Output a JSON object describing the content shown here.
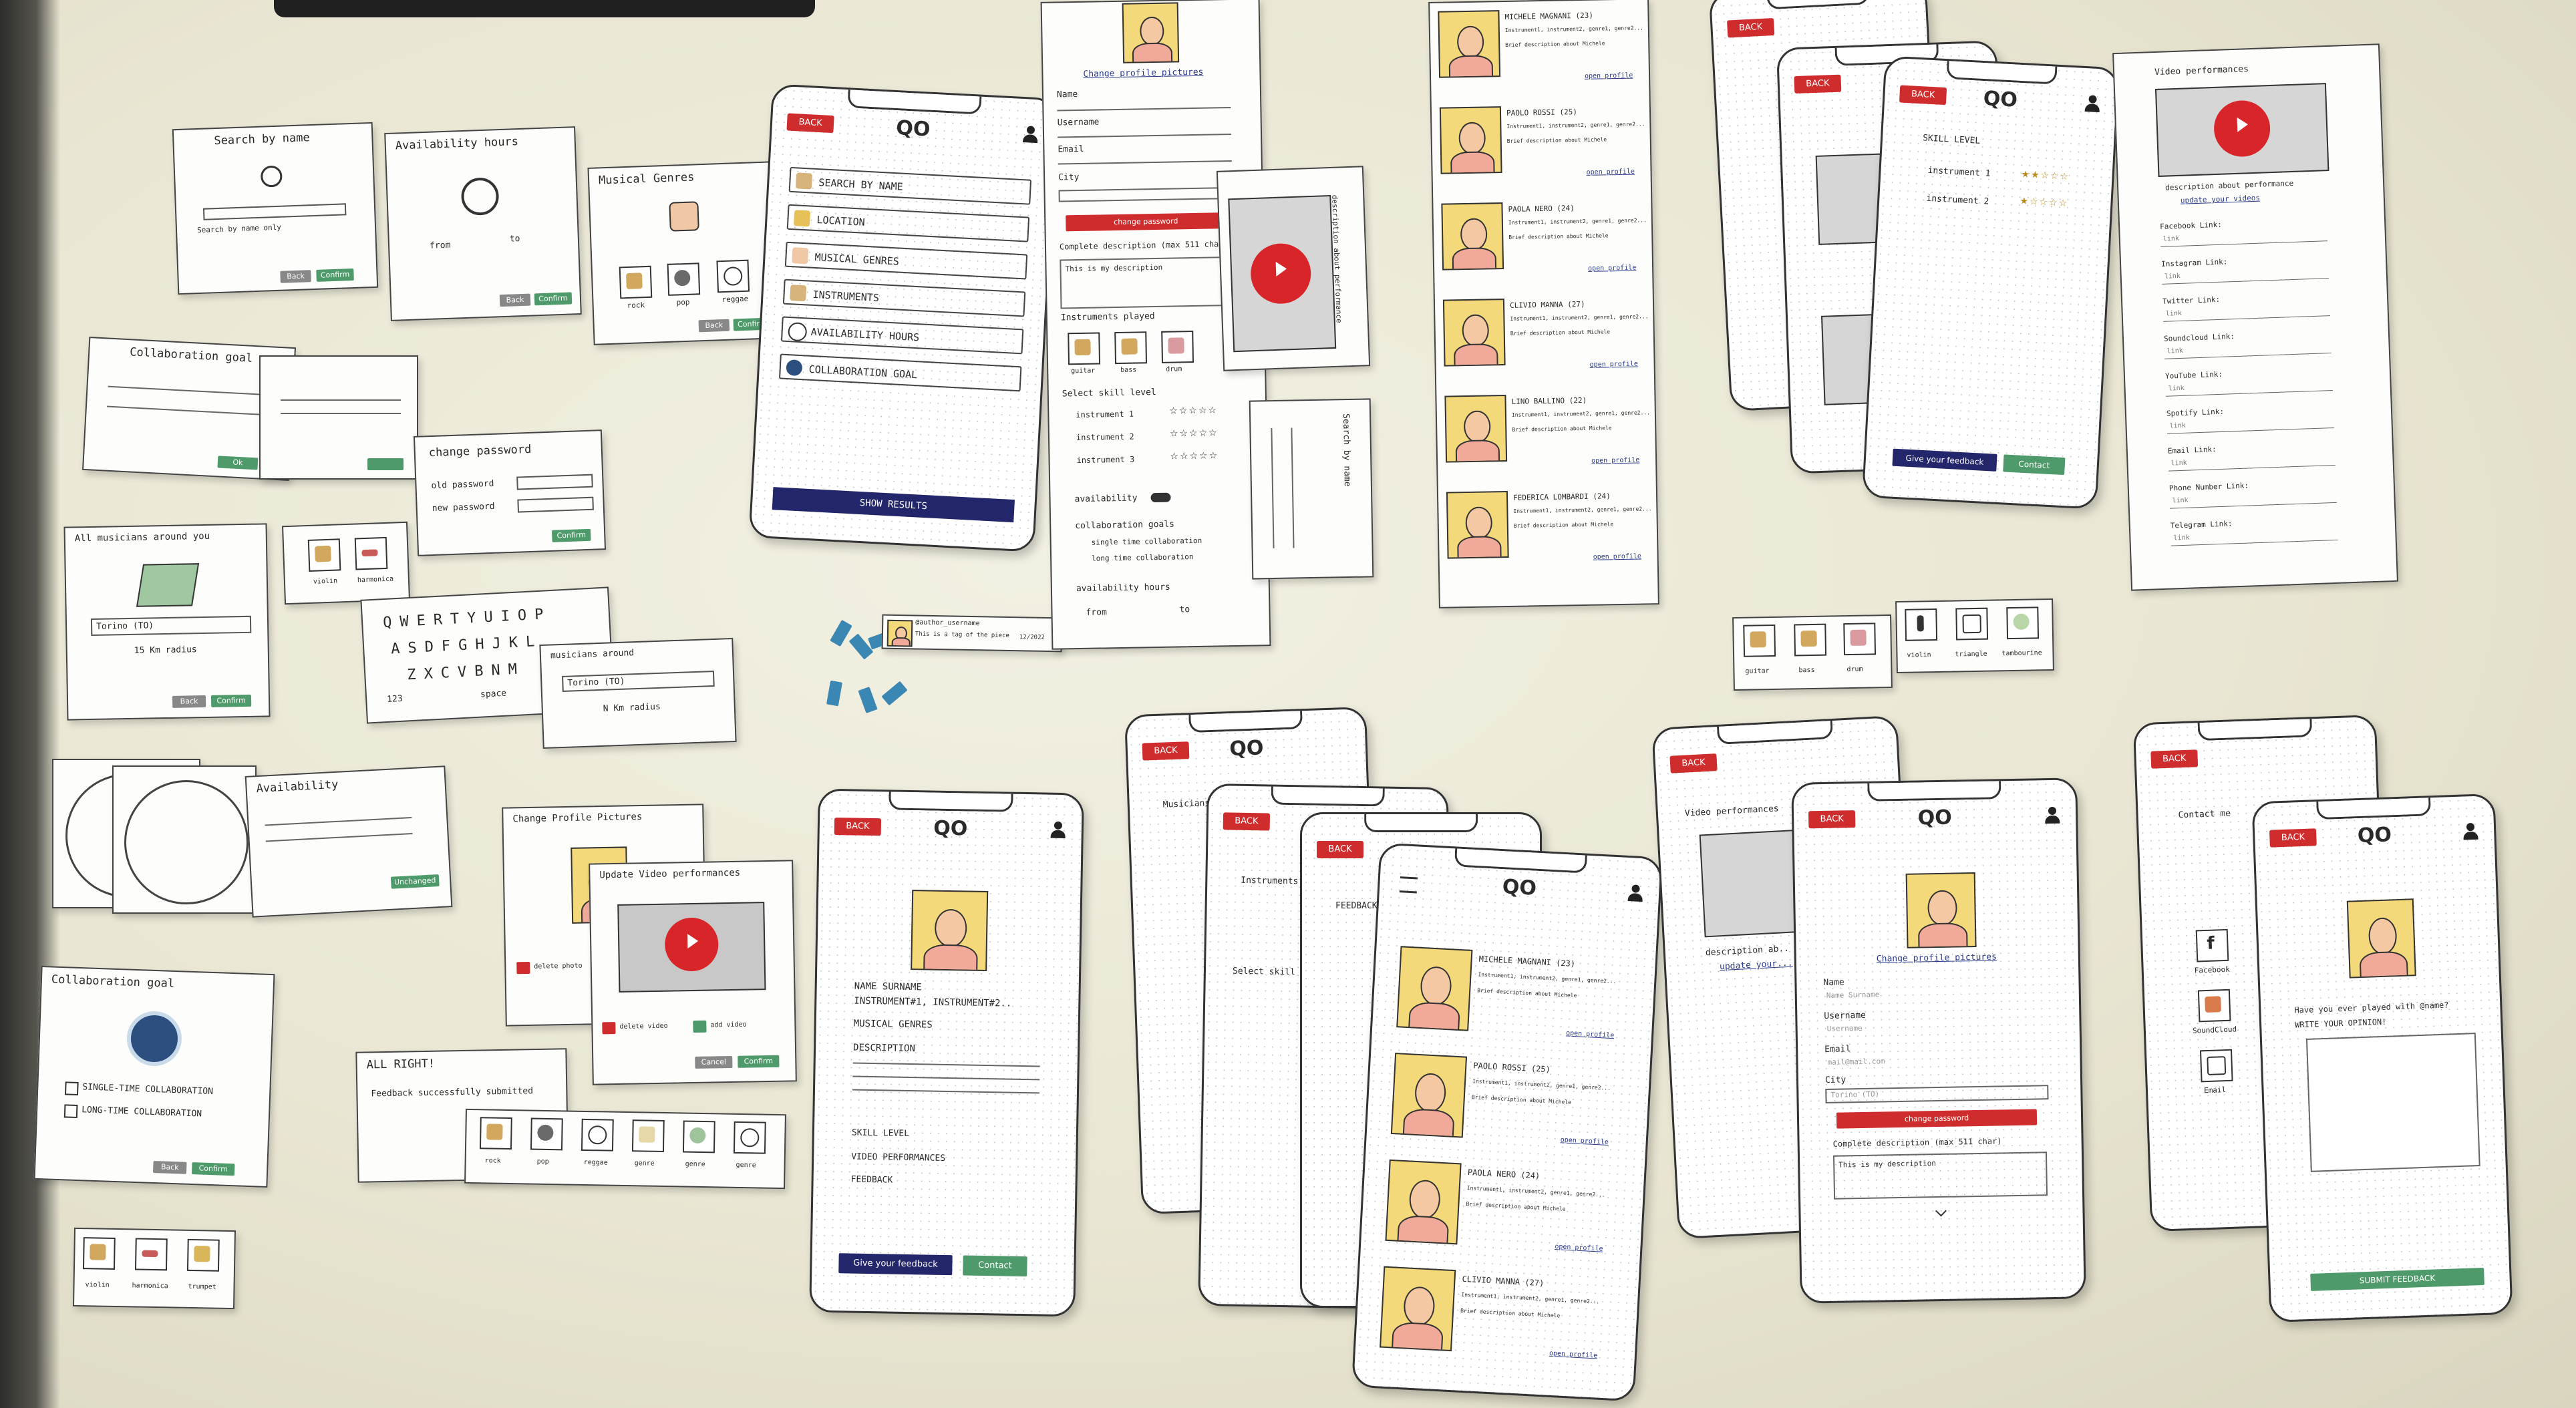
{
  "scene": {
    "description_label": "",
    "colors": {
      "desk": "#e9e6d3",
      "paper": "#fdfdfb",
      "brand_red": "#cf2d2d",
      "navy": "#23266a",
      "green": "#4f9a6a",
      "face_yellow": "#f4d97a",
      "play_red": "#d8252a"
    }
  },
  "cards": {
    "search_by_name": {
      "title": "Search by name",
      "line": "Search by name only",
      "back": "Back",
      "confirm": "Confirm"
    },
    "availability_hours": {
      "title": "Availability hours",
      "from": "from",
      "to": "to",
      "back": "Back",
      "confirm": "Confirm"
    },
    "musical_genres": {
      "title": "Musical Genres",
      "labels": [
        "rock",
        "pop",
        "reggae"
      ],
      "back": "Back",
      "confirm": "Confirm"
    },
    "collaboration_goal_small": {
      "title": "Collaboration goal",
      "ok": "Ok"
    },
    "change_password": {
      "title": "change password",
      "old": "old password",
      "new": "new password",
      "confirm": "Confirm"
    },
    "all_musicians": {
      "title": "All musicians around you",
      "field": "Torino (TO)",
      "link": "15 Km radius",
      "back": "Back",
      "confirm": "Confirm"
    },
    "instr_chips_mid": {
      "labels": [
        "violin",
        "harmonica"
      ]
    },
    "musicians_around": {
      "title": "musicians around",
      "field": "Torino (TO)",
      "radius": "N Km radius"
    },
    "availability": {
      "title": "Availability",
      "confirm": "Unchanged"
    },
    "change_profile_pictures": {
      "title": "Change Profile Pictures",
      "delete": "delete photo"
    },
    "update_video": {
      "title": "Update Video performances",
      "delete": "delete video",
      "add": "add video",
      "cancel": "Cancel",
      "confirm": "Confirm"
    },
    "collaboration_goal": {
      "title": "Collaboration goal",
      "opt1": "SINGLE-TIME COLLABORATION",
      "opt2": "LONG-TIME COLLABORATION",
      "back": "Back",
      "confirm": "Confirm"
    },
    "all_right": {
      "title": "ALL RIGHT!",
      "msg": "Feedback successfully submitted"
    },
    "genre_row": {
      "labels": [
        "rock",
        "pop",
        "reggae",
        "genre",
        "genre",
        "genre"
      ]
    },
    "instr_chips_bottom": {
      "labels": [
        "violin",
        "harmonica",
        "trumpet"
      ]
    },
    "instr_chips_right": {
      "labels": [
        "guitar",
        "bass",
        "drum",
        "violin",
        "triangle",
        "tambourine"
      ]
    }
  },
  "search_phone": {
    "back": "BACK",
    "logo": "QO",
    "rows": [
      "SEARCH BY NAME",
      "LOCATION",
      "MUSICAL GENRES",
      "INSTRUMENTS",
      "AVAILABILITY HOURS",
      "COLLABORATION GOAL"
    ],
    "show_results": "SHOW RESULTS"
  },
  "edit_profile_strip": {
    "change_pics": "Change profile pictures",
    "fields": [
      "Name",
      "Username",
      "Email",
      "City"
    ],
    "change_password": "change password",
    "comp_desc": "Complete description (max 511 char)",
    "desc_placeholder": "This is my description",
    "instruments_played": "Instruments played",
    "instr_labels": [
      "guitar",
      "bass",
      "drum"
    ],
    "skill": "Select skill level",
    "instruments": [
      "instrument 1",
      "instrument 2",
      "instrument 3"
    ],
    "availability": "availability",
    "collab_goals": "collaboration goals",
    "single": "single time collaboration",
    "long": "long time collaboration",
    "avail_hours": "availability hours",
    "from": "from",
    "to": "to"
  },
  "video_card": {
    "caption": "description about performance"
  },
  "search_by_name_strip": {
    "title": "Search by name"
  },
  "results_strip": {
    "entries": [
      {
        "name": "MICHELE MAGNANI (23)",
        "link": "open profile"
      },
      {
        "name": "PAOLO ROSSI (25)",
        "link": "open profile"
      },
      {
        "name": "PAOLA NERO (24)",
        "link": "open profile"
      },
      {
        "name": "CLIVIO MANNA (27)",
        "link": "open profile"
      },
      {
        "name": "LINO BALLINO (22)",
        "link": "open profile"
      },
      {
        "name": "FEDERICA LOMBARDI (24)",
        "link": "open profile"
      }
    ],
    "line1": "Instrument1, instrument2, genre1, genre2...",
    "line2": "Brief description about Michele"
  },
  "skill_phones": {
    "back": "BACK",
    "skill": "SKILL LEVEL",
    "instrument1": "instrument 1",
    "instrument2": "instrument 2",
    "feedback": "Give your feedback",
    "contact": "Contact"
  },
  "video_strip_right": {
    "title": "Video performances",
    "caption": "description about performance",
    "update": "update your videos",
    "links": [
      "Facebook Link:",
      "Instagram Link:",
      "Twitter Link:",
      "Soundcloud Link:",
      "YouTube Link:",
      "Spotify Link:",
      "Email Link:",
      "Phone Number Link:",
      "Telegram Link:"
    ],
    "link_value": "link"
  },
  "profile_phone": {
    "back": "BACK",
    "logo": "QO",
    "name": "NAME SURNAME",
    "instruments": "INSTRUMENT#1, INSTRUMENT#2..",
    "genres": "MUSICAL GENRES",
    "description": "DESCRIPTION",
    "sections": [
      "SKILL LEVEL",
      "VIDEO PERFORMANCES",
      "FEEDBACK"
    ],
    "feedback": "Give your feedback",
    "contact": "Contact"
  },
  "stack_phones": {
    "musicians": "Musicians",
    "instruments": "Instruments",
    "feedback": "FEEDBACK",
    "skill": "Select skill level"
  },
  "results_phone": {
    "logo": "QO",
    "entries": [
      {
        "name": "MICHELE MAGNANI (23)",
        "link": "open profile"
      },
      {
        "name": "PAOLO ROSSI (25)",
        "link": "open profile"
      },
      {
        "name": "PAOLA NERO (24)",
        "link": "open profile"
      },
      {
        "name": "CLIVIO MANNA (27)",
        "link": "open profile"
      }
    ],
    "line1": "Instrument1, instrument2, genre1, genre2...",
    "line2": "Brief description about Michele"
  },
  "video_phone": {
    "back": "BACK",
    "title": "Video performances",
    "caption": "description ab..",
    "update": "update your..."
  },
  "edit_phone": {
    "back": "BACK",
    "logo": "QO",
    "change_pics": "Change profile pictures",
    "fields": [
      "Name",
      "Username",
      "Email",
      "City"
    ],
    "name_val": "Name Surname",
    "user_val": "Username",
    "email_val": "mail@mail.com",
    "city_val": "Torino (TO)",
    "change_password": "change password",
    "comp_desc": "Complete description (max 511 char)",
    "desc_val": "This is my description"
  },
  "contact_phone": {
    "back": "BACK",
    "title": "Contact me",
    "links": [
      "Facebook",
      "SoundCloud",
      "Email"
    ]
  },
  "feedback_phone": {
    "back": "BACK",
    "logo": "QO",
    "question": "Have you ever played with @name?",
    "write": "WRITE YOUR OPINION!",
    "submit": "SUBMIT FEEDBACK"
  },
  "keyboard": {
    "rows": [
      "QWERTYUIOP",
      "ASDFGHJKL",
      "ZXCVBNM"
    ],
    "num": "123",
    "space": "space"
  },
  "tag_strip": {
    "name": "@author_username",
    "line": "This is a tag of the piece",
    "date": "12/2022"
  }
}
